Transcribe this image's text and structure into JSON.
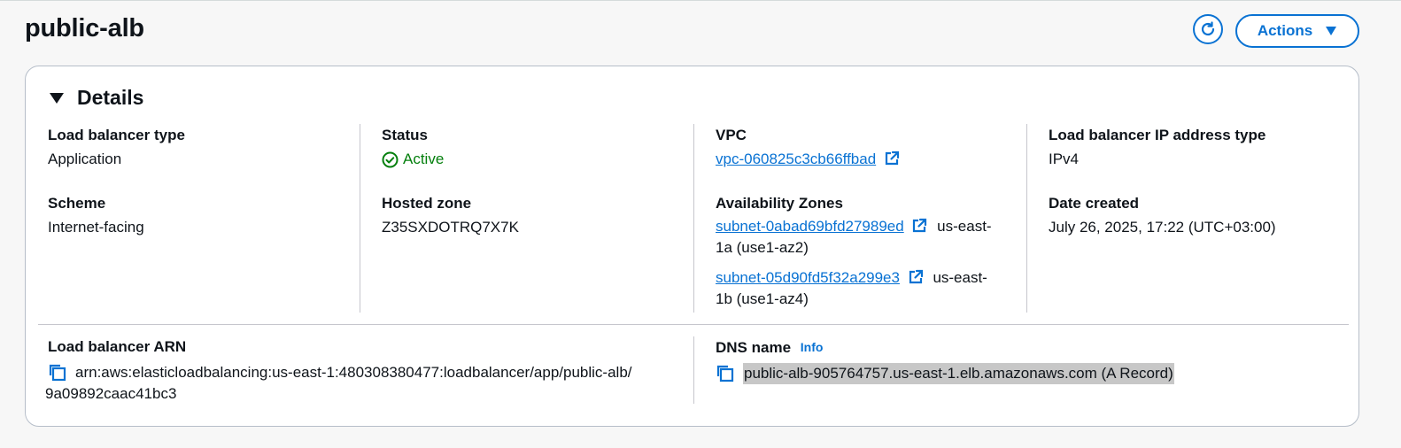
{
  "page": {
    "title": "public-alb"
  },
  "toolbar": {
    "actions_label": "Actions"
  },
  "details": {
    "section_title": "Details",
    "load_balancer_type": {
      "label": "Load balancer type",
      "value": "Application"
    },
    "scheme": {
      "label": "Scheme",
      "value": "Internet-facing"
    },
    "status": {
      "label": "Status",
      "value": "Active"
    },
    "hosted_zone": {
      "label": "Hosted zone",
      "value": "Z35SXDOTRQ7X7K"
    },
    "vpc": {
      "label": "VPC",
      "value": "vpc-060825c3cb66ffbad"
    },
    "availability_zones": {
      "label": "Availability Zones",
      "items": [
        {
          "subnet": "subnet-0abad69bfd27989ed",
          "zone_line1": "us-east-",
          "zone_line2": "1a (use1-az2)"
        },
        {
          "subnet": "subnet-05d90fd5f32a299e3",
          "zone_line1": "us-east-",
          "zone_line2": "1b (use1-az4)"
        }
      ]
    },
    "ip_address_type": {
      "label": "Load balancer IP address type",
      "value": "IPv4"
    },
    "date_created": {
      "label": "Date created",
      "value": "July 26, 2025, 17:22 (UTC+03:00)"
    },
    "arn": {
      "label": "Load balancer ARN",
      "line1": "arn:aws:elasticloadbalancing:us-east-1:480308380477:loadbalancer/app/public-alb/",
      "line2": "9a09892caac41bc3"
    },
    "dns_name": {
      "label": "DNS name",
      "info": "Info",
      "value": "public-alb-905764757.us-east-1.elb.amazonaws.com (A Record)"
    }
  },
  "colors": {
    "accent": "#0972d3",
    "success": "#037f0c",
    "highlight": "#c7c7c7"
  }
}
